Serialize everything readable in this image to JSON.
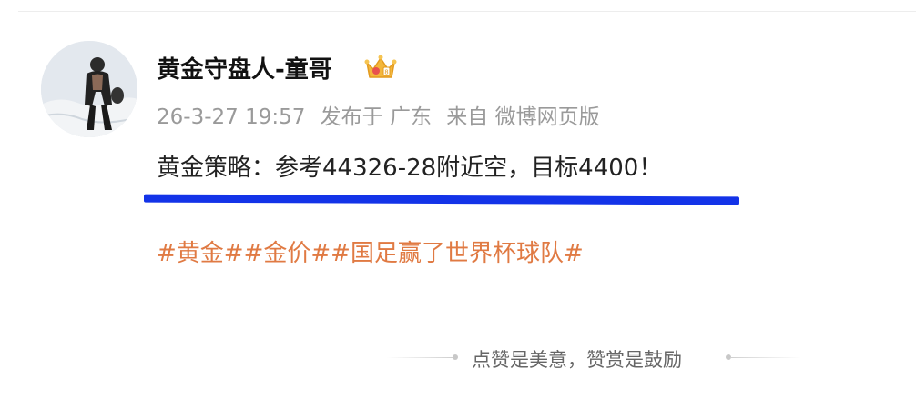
{
  "post": {
    "username": "黄金守盘人-童哥",
    "badge_icon": "crown-badge-icon",
    "timestamp": "26-3-27 19:57",
    "location": "发布于 广东",
    "source": "来自 微博网页版",
    "content": "黄金策略：参考44326-28附近空，目标4400！",
    "hashtags": [
      "#黄金#",
      "#金价#",
      "#国足赢了世界杯球队#"
    ]
  },
  "footer": {
    "reward_text": "点赞是美意，赞赏是鼓励"
  },
  "colors": {
    "hashtag": "#e07a43",
    "annotation_underline": "#1333e8",
    "meta_text": "#9a9a9a"
  }
}
